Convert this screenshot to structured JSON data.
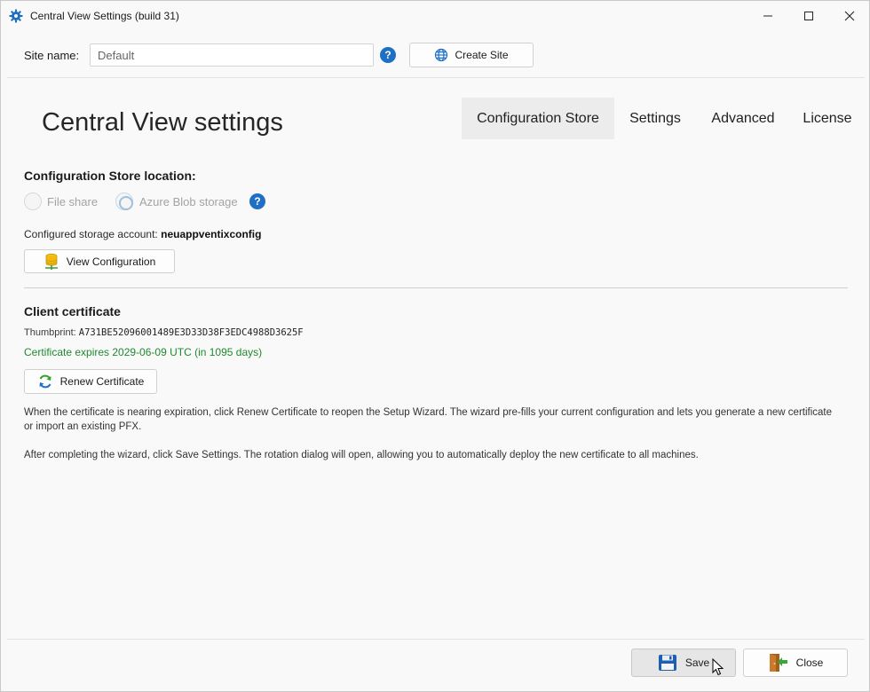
{
  "window": {
    "title": "Central View Settings (build 31)",
    "icons": {
      "app": "gear-icon",
      "minimize": "minimize-icon",
      "maximize": "maximize-icon",
      "close": "close-icon"
    }
  },
  "site": {
    "label": "Site name:",
    "value": "Default",
    "help_glyph": "?",
    "create_label": "Create Site"
  },
  "header": {
    "title": "Central View settings",
    "tabs": [
      {
        "label": "Configuration Store",
        "selected": true
      },
      {
        "label": "Settings",
        "selected": false
      },
      {
        "label": "Advanced",
        "selected": false
      },
      {
        "label": "License",
        "selected": false
      }
    ]
  },
  "store": {
    "heading": "Configuration Store location:",
    "options": [
      {
        "label": "File share",
        "selected": false,
        "enabled": false
      },
      {
        "label": "Azure Blob storage",
        "selected": true,
        "enabled": false
      }
    ],
    "account_label": "Configured storage account:",
    "account_value": "neuappventixconfig",
    "view_label": "View Configuration"
  },
  "certificate": {
    "heading": "Client certificate",
    "thumbprint_label": "Thumbprint:",
    "thumbprint_value": "A731BE52096001489E3D33D38F3EDC4988D3625F",
    "expires": "Certificate expires 2029-06-09 UTC (in 1095 days)",
    "renew_label": "Renew Certificate",
    "para1": "When the certificate is nearing expiration, click Renew Certificate to reopen the Setup Wizard. The wizard pre-fills your current configuration and lets you generate a new certificate or import an existing PFX.",
    "para2": "After completing the wizard, click Save Settings. The rotation dialog will open, allowing you to automatically deploy the new certificate to all machines."
  },
  "footer": {
    "save_label": "Save",
    "close_label": "Close"
  },
  "colors": {
    "accent": "#1f6fc5",
    "success": "#1f8a2e",
    "selected_tab": "#ececec"
  }
}
